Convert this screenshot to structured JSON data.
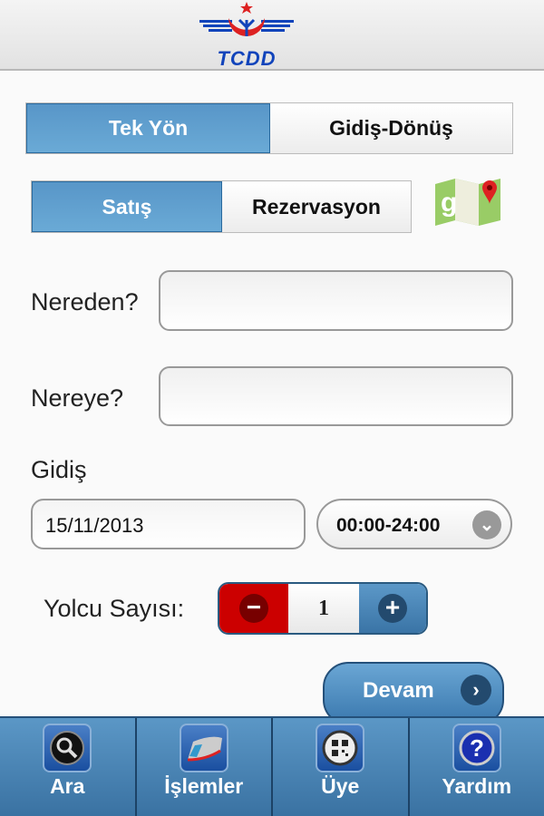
{
  "header": {
    "logo_text": "TCDD"
  },
  "trip_type": {
    "options": [
      "Tek Yön",
      "Gidiş-Dönüş"
    ],
    "selected": "Tek Yön"
  },
  "mode": {
    "options": [
      "Satış",
      "Rezervasyon"
    ],
    "selected": "Satış"
  },
  "form": {
    "from_label": "Nereden?",
    "from_value": "",
    "to_label": "Nereye?",
    "to_value": "",
    "departure_label": "Gidiş",
    "date": "15/11/2013",
    "time_range": "00:00-24:00",
    "passenger_label": "Yolcu Sayısı:",
    "passenger_count": "1"
  },
  "continue_label": "Devam",
  "tabs": [
    {
      "label": "Ara",
      "icon": "search-icon"
    },
    {
      "label": "İşlemler",
      "icon": "train-icon"
    },
    {
      "label": "Üye",
      "icon": "qr-code-icon"
    },
    {
      "label": "Yardım",
      "icon": "help-icon"
    }
  ],
  "colors": {
    "accent": "#5896c8",
    "minus": "#cc0000",
    "logo_blue": "#1144bb",
    "logo_red": "#dd2200"
  }
}
